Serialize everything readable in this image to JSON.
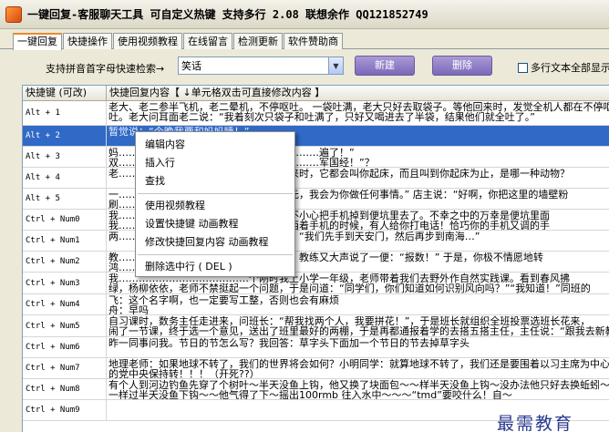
{
  "window": {
    "title": "一键回复-客服聊天工具  可自定义热键  支持多行 2.08   联想余作  QQ121852749"
  },
  "tabs": [
    {
      "label": "一键回复",
      "active": true
    },
    {
      "label": "快捷操作"
    },
    {
      "label": "使用视频教程"
    },
    {
      "label": "在线留言"
    },
    {
      "label": "检测更新"
    },
    {
      "label": "软件赞助商"
    }
  ],
  "toolbar": {
    "search_label": "支持拼音首字母快速检索→",
    "search_value": "笑话",
    "new_label": "新建",
    "delete_label": "删除",
    "multiline_label": "多行文本全部显示"
  },
  "grid": {
    "headers": [
      "快捷键 (可改)",
      "快捷回复内容【 ↓单元格双击可直接修改内容 】"
    ],
    "rows": [
      {
        "key": "Alt + 1",
        "line1": "老大、老二参半飞机，老二晕机，不停呕吐。 一袋吐满，老大只好去取袋子。等他回来时，发觉全机人都在不停呕",
        "line2": "吐。老大问耳面老二说：“我着刻次只袋子和吐满了，只好又喝进去了半袋，结果他们就全吐了。”"
      },
      {
        "key": "Alt + 2",
        "line1": "暂觉说：“今晚我要和妈妈睡！”",
        "line2": "",
        "selected": true
      },
      {
        "key": "Alt + 3",
        "line1": "妈……………………………………………………遍了！”",
        "line2": "双……………………………………………………军国经！”？"
      },
      {
        "key": "Alt + 4",
        "line1": "老……………………………………公公出来时，它都会叫你起床，而且叫到你起床为止，是哪一种动物？",
        "line2": ""
      },
      {
        "key": "Alt + 5",
        "line1": "一…………………………………………百元，我会为你做任何事情。” 店主说：“好啊，你把这里的墙壁粉",
        "line2": "刷…………………………"
      },
      {
        "key": "Ctrl + Num0",
        "line1": "我…………………………………所的时候不小心把手机掉到便坑里去了。不幸之中的万幸是便坑里面",
        "line2": "我…………………………………准备找东西着手机的时候，有人给你打电话！恰巧你的手机又调的手"
      },
      {
        "key": "Ctrl + Num1",
        "line1": "两…………………………………咖啡，甲：“我们先手到天安门，然后再步到南海…”",
        "line2": ""
      },
      {
        "key": "Ctrl + Num2",
        "line1": "教…………………………………为看教练，教练又大声说了一便：“报数！” 于是，你极不情愿地转",
        "line2": "鸿…………………………"
      },
      {
        "key": "Ctrl + Num3",
        "line1": "我…………………………………个刚时我上小学一年级，老师带着我们去野外作自然实践课。看到春风拂",
        "line2": "绿，杨柳依依，老师不禁挺起一个问题，于是问道：“同学们，你们知道如何识别风向吗？”“我知道！”同班的"
      },
      {
        "key": "Ctrl + Num4",
        "line1": "飞：这个名字啊，也一定要写工整，否则也会有麻烦",
        "line2": "舟：早吗"
      },
      {
        "key": "Ctrl + Num5",
        "line1": "自习课时，数务主任走进来，问班长：“帮我找两个人，我要拼花！”，于是班长就组织全班投票选班长花来，",
        "line2": "闹了一节课，终于选一个意见，送出了班里最好的两棚，于是再都通报着学的去搭五搭主任，主任说：“跟我去新教第，"
      },
      {
        "key": "Ctrl + Num6",
        "line1": "昨一同事问我。节日的节怎么写？我回答：草字头下面加一个节日的节去掉草字头",
        "line2": ""
      },
      {
        "key": "Ctrl + Num7",
        "line1": "地理老师：如果地球不转了，我们的世界将会如何？小明同学：就算地球不转了，我们还是要围着以习主席为中心",
        "line2": "的党中央保持转！！！（开死??）"
      },
      {
        "key": "Ctrl + Num8",
        "line1": "有个人到河边钓鱼先穿了个树叶～半天没鱼上钩，他又换了块面包～～样半天没鱼上钩～没办法他只好去换蚯蚓～",
        "line2": "一样过半天没鱼下钩～～他气得了下～摇出100rmb 往入水中～～～“tmd”要咬什么！自～"
      },
      {
        "key": "Ctrl + Num9",
        "line1": "",
        "line2": ""
      }
    ]
  },
  "context_menu": {
    "groups": [
      [
        "编辑内容",
        "插入行",
        "查找"
      ],
      [
        "使用视频教程",
        "设置快捷键 动画教程",
        "修改快捷回复内容 动画教程"
      ],
      [
        "删除选中行 ( DEL )"
      ]
    ]
  },
  "watermark": "最需教育"
}
